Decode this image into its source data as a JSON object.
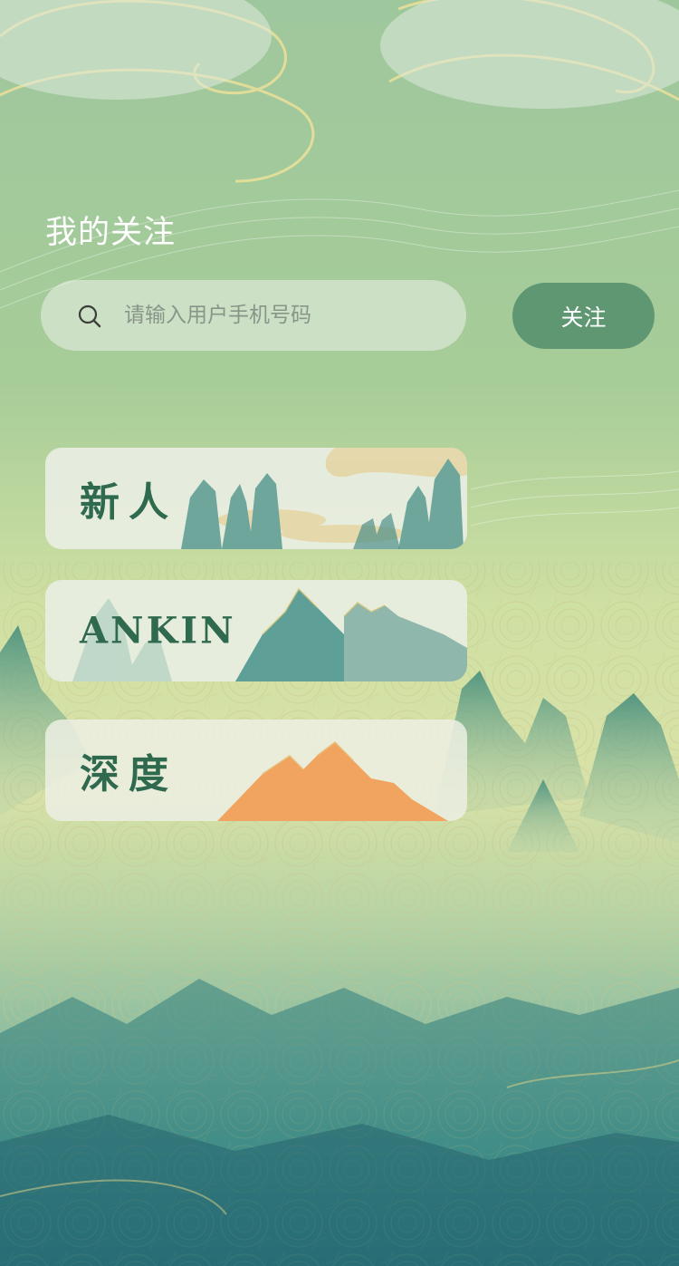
{
  "header": {
    "title": "我的关注"
  },
  "search": {
    "placeholder": "请输入用户手机号码",
    "value": "",
    "icon": "search-icon"
  },
  "follow_button": {
    "label": "关注"
  },
  "groups": [
    {
      "label": "新人"
    },
    {
      "label": "ANKIN"
    },
    {
      "label": "深度"
    }
  ],
  "colors": {
    "accent": "#5f9773",
    "label_text": "#2f6a4f",
    "bg_top": "#a4c9a0",
    "bg_bottom": "#2f7d7e"
  }
}
